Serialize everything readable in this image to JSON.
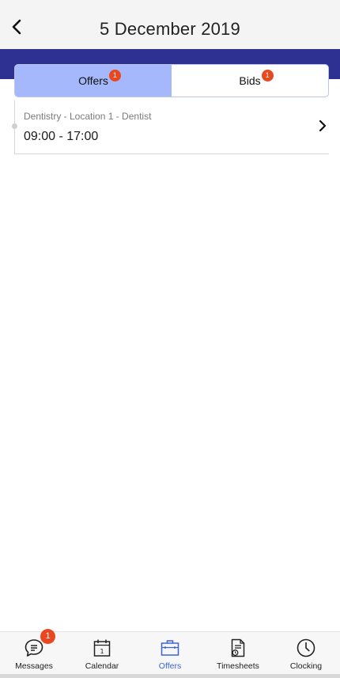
{
  "header": {
    "title": "5 December 2019",
    "back_icon": "chevron-left-icon"
  },
  "colors": {
    "accent_band": "#2e3192",
    "active_tab": "#a5b8fb",
    "badge": "#e9471f",
    "nav_active": "#3b63d6"
  },
  "tabs": [
    {
      "label": "Offers",
      "badge": "1",
      "active": true
    },
    {
      "label": "Bids",
      "badge": "1",
      "active": false
    }
  ],
  "offers": [
    {
      "subtitle": "Dentistry - Location 1 - Dentist",
      "time": "09:00 - 17:00",
      "icon": "chevron-right-icon"
    }
  ],
  "nav": [
    {
      "label": "Messages",
      "icon": "chat-bubble-icon",
      "badge": "1",
      "active": false
    },
    {
      "label": "Calendar",
      "icon": "calendar-icon",
      "day": "1",
      "active": false
    },
    {
      "label": "Offers",
      "icon": "briefcase-icon",
      "active": true
    },
    {
      "label": "Timesheets",
      "icon": "timesheet-document-icon",
      "active": false
    },
    {
      "label": "Clocking",
      "icon": "clock-icon",
      "active": false
    }
  ]
}
